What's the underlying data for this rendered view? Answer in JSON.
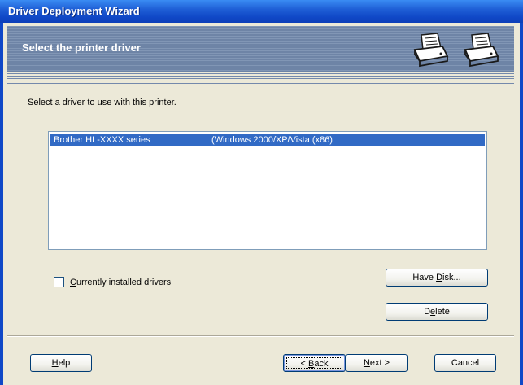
{
  "window": {
    "title": "Driver Deployment Wizard"
  },
  "banner": {
    "title": "Select the printer driver"
  },
  "instruction": "Select a driver to use with this printer.",
  "drivers": [
    {
      "name": "Brother HL-XXXX series",
      "platform": "(Windows 2000/XP/Vista (x86)",
      "selected": true
    }
  ],
  "checkbox": {
    "label_pre": "",
    "label_u": "C",
    "label_post": "urrently installed drivers",
    "checked": false
  },
  "buttons": {
    "have_disk": {
      "pre": "Have ",
      "u": "D",
      "post": "isk..."
    },
    "delete": {
      "pre": "D",
      "u": "e",
      "post": "lete"
    },
    "help": {
      "pre": "",
      "u": "H",
      "post": "elp"
    },
    "back": {
      "pre": "< ",
      "u": "B",
      "post": "ack"
    },
    "next": {
      "pre": "",
      "u": "N",
      "post": "ext >"
    },
    "cancel": {
      "pre": "Cancel",
      "u": "",
      "post": ""
    }
  },
  "icons": [
    "printer-icon",
    "printer-icon"
  ]
}
